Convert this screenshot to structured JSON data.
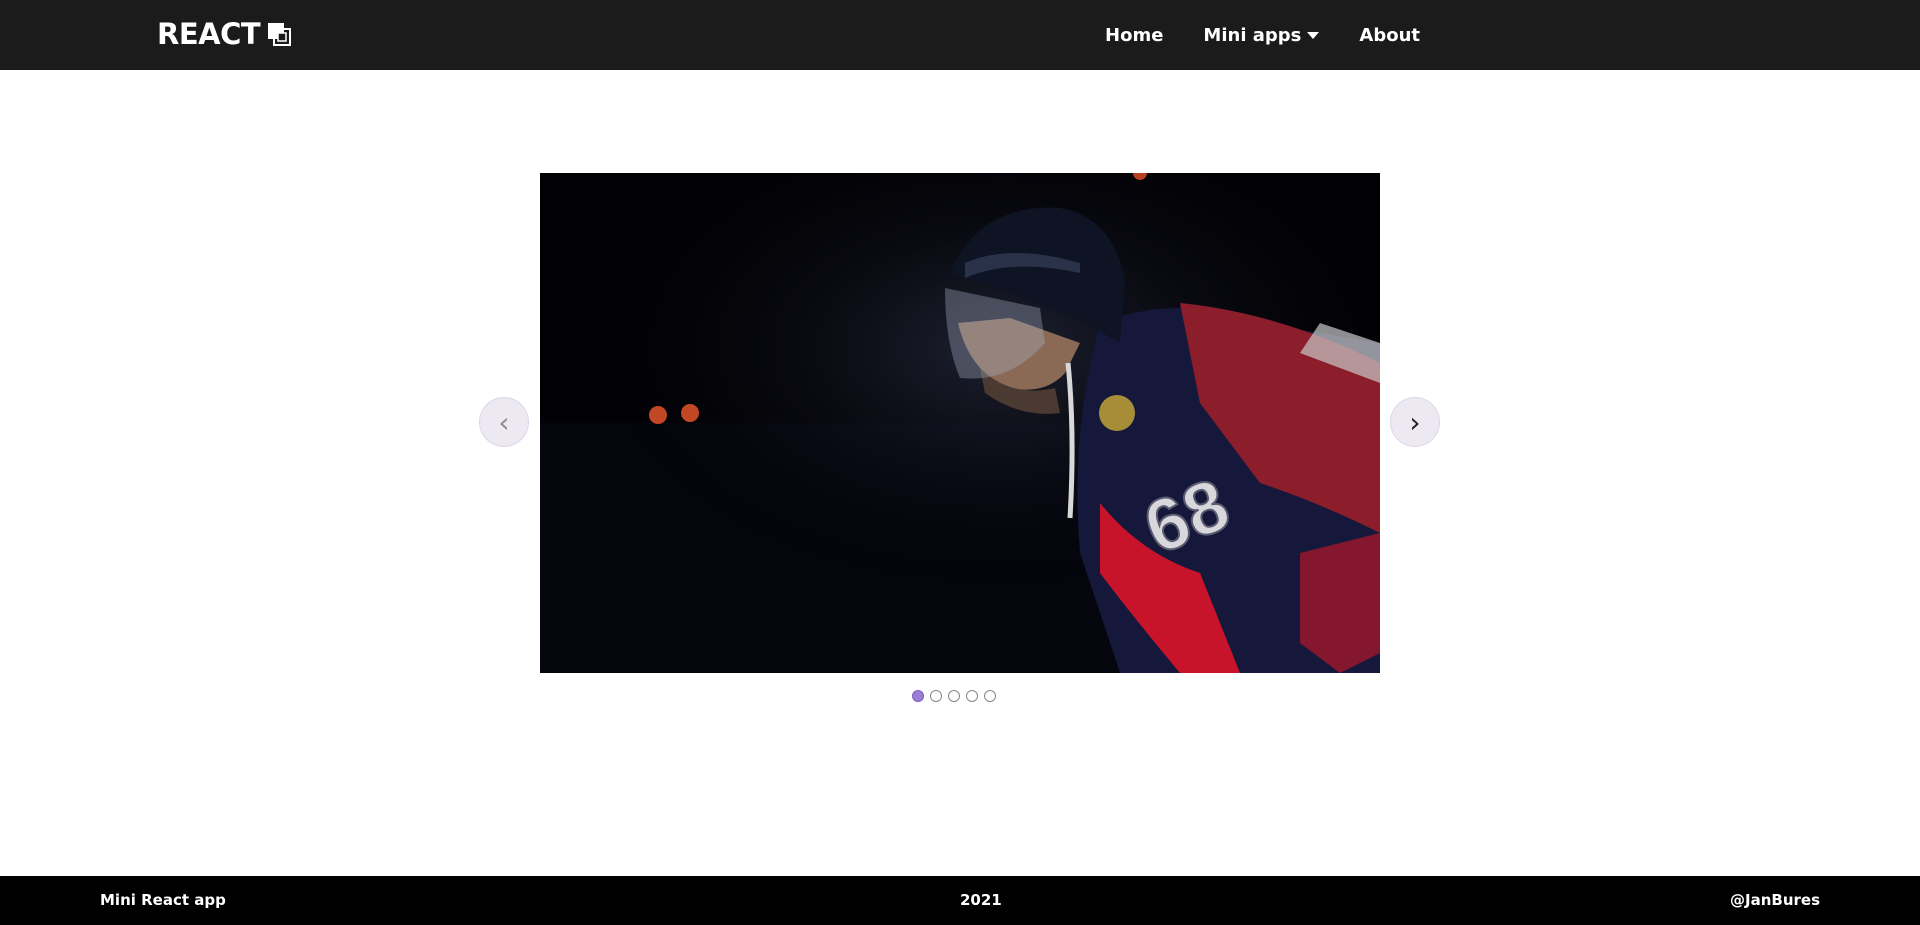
{
  "header": {
    "brand": "REACT",
    "nav": {
      "home": "Home",
      "mini_apps": "Mini apps",
      "about": "About"
    }
  },
  "carousel": {
    "prev_arrow": "‹",
    "next_arrow": "›",
    "slide_jersey_number": "68",
    "slide_count": 5,
    "active_index": 0
  },
  "footer": {
    "left": "Mini React app",
    "center": "2021",
    "right": "@JanBures"
  },
  "colors": {
    "navbar_bg": "#1c1b1c",
    "footer_bg": "#000000",
    "active_dot": "#9b7fd6",
    "arrow_bg": "#ece9f3"
  }
}
